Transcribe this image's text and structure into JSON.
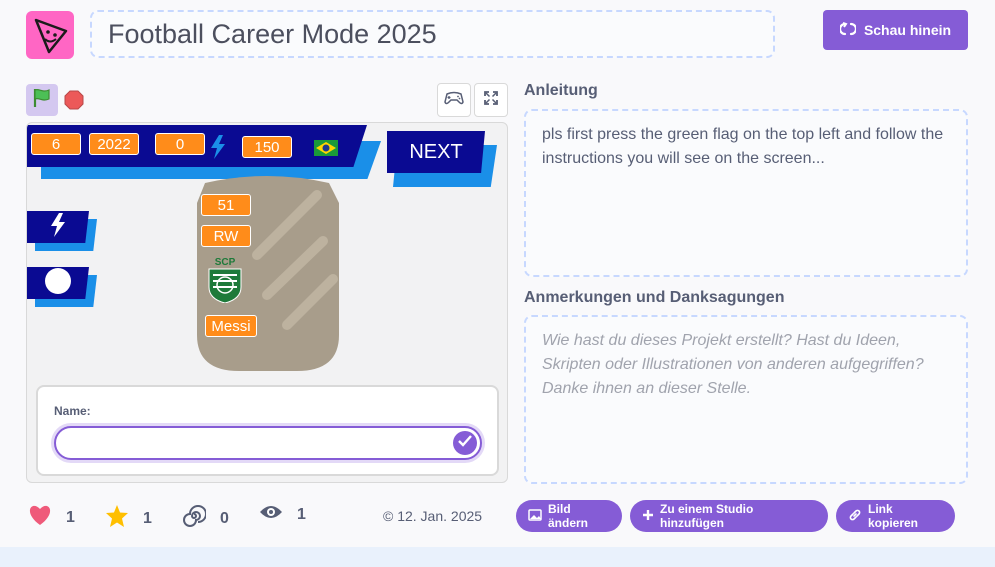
{
  "project": {
    "title": "Football Career Mode 2025",
    "see_inside": "Schau hinein"
  },
  "stage": {
    "hud": [
      "6",
      "2022",
      "0",
      "150"
    ],
    "next_label": "NEXT",
    "card": {
      "rating": "51",
      "position": "RW",
      "club_badge_text": "SCP",
      "player_name": "Messi"
    },
    "ask": {
      "label": "Name:",
      "value": ""
    }
  },
  "instructions": {
    "heading": "Anleitung",
    "text": "pls first press the green flag on the top left and follow the instructions you will see on the screen..."
  },
  "notes": {
    "heading": "Anmerkungen und Danksagungen",
    "placeholder": "Wie hast du dieses Projekt erstellt? Hast du Ideen, Skripten oder Illustrationen von anderen aufgegriffen? Danke ihnen an dieser Stelle."
  },
  "stats": {
    "loves": "1",
    "favorites": "1",
    "remixes": "0",
    "views": "1"
  },
  "date": "© 12. Jan. 2025",
  "actions": {
    "change_image": "Bild ändern",
    "add_to_studio": "Zu einem Studio hinzufügen",
    "copy_link": "Link kopieren"
  },
  "colors": {
    "accent": "#855cd6",
    "stage_orange": "#ff8c1a",
    "stage_navy": "#0a0a92",
    "stage_blue": "#1a8fe8",
    "love": "#ef5a7a",
    "star": "#ffbf00"
  },
  "icons": [
    "project-avatar-icon",
    "remix-icon",
    "green-flag-icon",
    "stop-icon",
    "gamepad-icon",
    "fullscreen-icon",
    "lightning-icon",
    "brazil-flag-icon",
    "checkmark-icon",
    "heart-icon",
    "star-icon",
    "remix-spiral-icon",
    "eye-icon",
    "image-icon",
    "plus-icon",
    "link-icon"
  ]
}
